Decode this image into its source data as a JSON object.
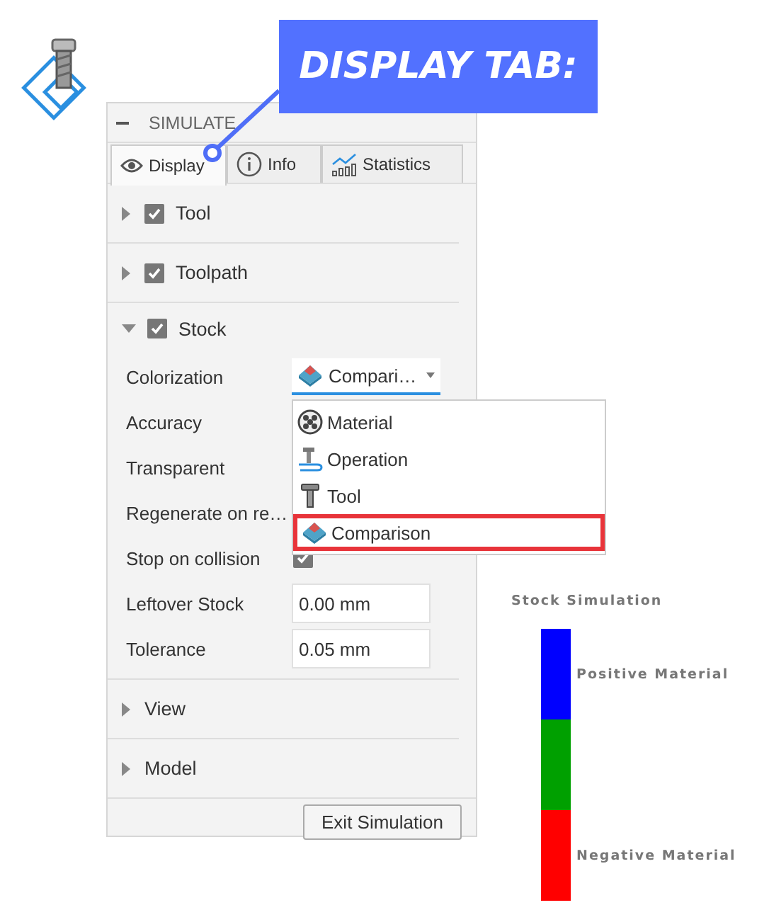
{
  "callout": {
    "text": "DISPLAY TAB:"
  },
  "panel": {
    "title": "SIMULATE",
    "tabs": [
      {
        "label": "Display",
        "selected": true
      },
      {
        "label": "Info",
        "selected": false
      },
      {
        "label": "Statistics",
        "selected": false
      }
    ],
    "sections": [
      {
        "kind": "check",
        "label": "Tool",
        "expanded": false,
        "checked": true
      },
      {
        "kind": "check",
        "label": "Toolpath",
        "expanded": false,
        "checked": true
      },
      {
        "kind": "check",
        "label": "Stock",
        "expanded": true,
        "checked": true,
        "properties": [
          {
            "kind": "dropdown",
            "label": "Colorization",
            "value": "Compari…"
          },
          {
            "kind": "label",
            "label": "Accuracy"
          },
          {
            "kind": "label",
            "label": "Transparent"
          },
          {
            "kind": "label",
            "label": "Regenerate on re…"
          },
          {
            "kind": "checkbox",
            "label": "Stop on collision",
            "checked": true
          },
          {
            "kind": "input",
            "label": "Leftover Stock",
            "value": "0.00 mm"
          },
          {
            "kind": "input",
            "label": "Tolerance",
            "value": "0.05 mm"
          }
        ]
      },
      {
        "kind": "plain",
        "label": "View",
        "expanded": false
      },
      {
        "kind": "plain",
        "label": "Model",
        "expanded": false
      }
    ],
    "dropdown_menu": [
      {
        "label": "Material",
        "selected": false
      },
      {
        "label": "Operation",
        "selected": false
      },
      {
        "label": "Tool",
        "selected": false
      },
      {
        "label": "Comparison",
        "selected": true
      }
    ],
    "exit_button": "Exit Simulation"
  },
  "legend": {
    "title": "Stock Simulation",
    "segments": [
      {
        "color": "#0000ff",
        "label": "Positive Material"
      },
      {
        "color": "#00a000"
      },
      {
        "color": "#ff0000",
        "label": "Negative Material"
      }
    ]
  }
}
